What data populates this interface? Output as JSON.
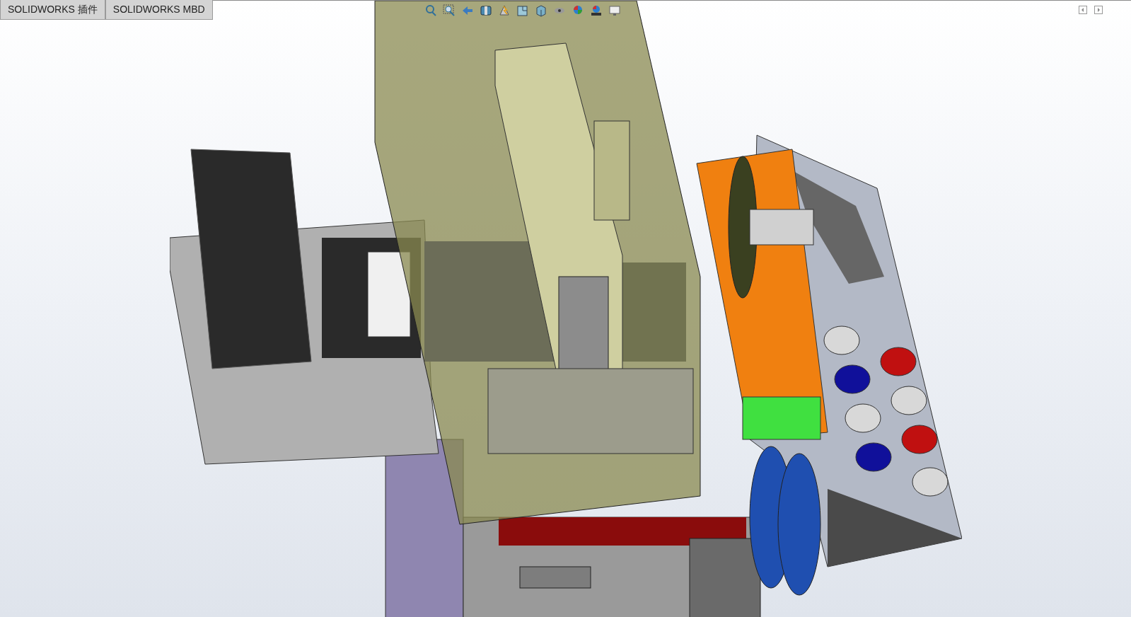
{
  "command_manager_tabs": [
    {
      "label": "SOLIDWORKS 插件"
    },
    {
      "label": "SOLIDWORKS MBD"
    }
  ]
}
